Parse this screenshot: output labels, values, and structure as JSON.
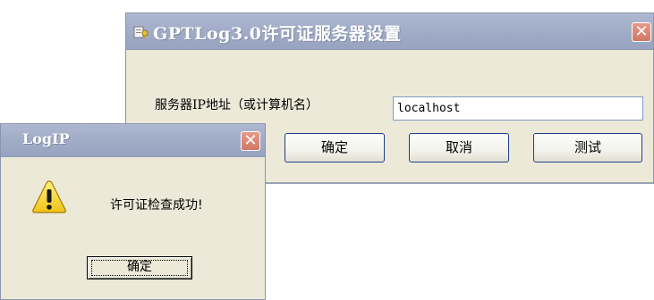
{
  "main_dialog": {
    "title": "GPTLog3.0许可证服务器设置",
    "close_glyph": "✕",
    "server_label": "服务器IP地址（或计算机名）",
    "server_value": "localhost",
    "buttons": {
      "ok": "确定",
      "cancel": "取消",
      "test": "测试"
    },
    "icon": "app-key-icon"
  },
  "message_box": {
    "title": "LogIP",
    "close_glyph": "✕",
    "message": "许可证检查成功!",
    "ok_label": "确定",
    "icon": "warning-icon"
  },
  "colors": {
    "titlebar_inactive": "#a2adc8",
    "dialog_face": "#ece9d8",
    "close_button": "#d07865"
  }
}
